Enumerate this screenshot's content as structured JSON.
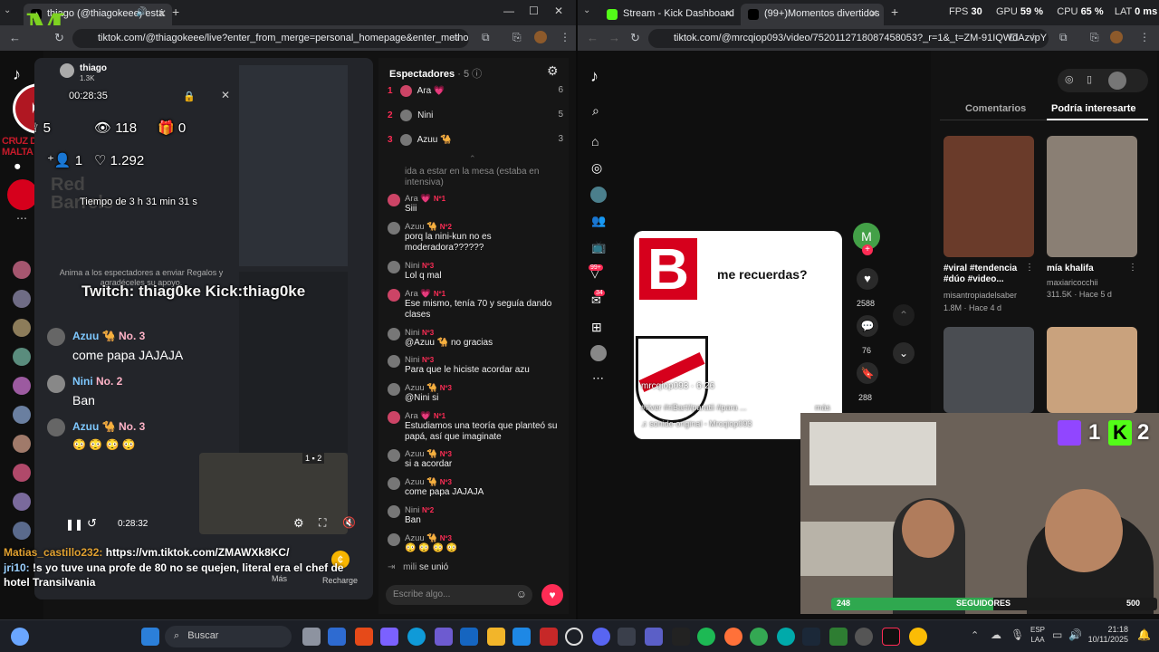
{
  "left_window": {
    "tab_title": "thiago (@thiagokeee) está",
    "url": "tiktok.com/@thiagokeee/live?enter_from_merge=personal_homepage&enter_method=othe..."
  },
  "stream": {
    "streamer_name": "thiago",
    "stream_viewers_small": "1.3K",
    "timer": "00:28:35",
    "stats": {
      "rank": "5",
      "viewers": "118",
      "gifts": "0",
      "follows": "1",
      "likes": "1.292"
    },
    "subathon": "Tiempo de 3 h 31 min 31 s",
    "team_logo_text": "CRUZ DE MALTA",
    "sponsor_text": "Red Barrels",
    "gift_hint": "Anima a los espectadores a enviar Regalos y agradéceles su apoyo.",
    "twitch_banner": "Twitch: thiag0ke Kick:thiag0ke",
    "overlay_chat": [
      {
        "user": "Azuu 🐪",
        "badge": "No. 3",
        "msg": "come papa JAJAJA"
      },
      {
        "user": "Nini",
        "badge": "No. 2",
        "msg": "Ban"
      },
      {
        "user": "Azuu 🐪",
        "badge": "No. 3",
        "msg": "😳 😳 😳 😳"
      }
    ],
    "player_time": "0:28:32",
    "twitch_counter": "1",
    "kick_counter": "2",
    "bottom_chat": [
      {
        "user": "Matias_castillo232:",
        "msg": "https://vm.tiktok.com/ZMAWXk8KC/"
      },
      {
        "user": "jri10:",
        "msg": "!s yo tuve una profe de 80 no se quejen, literal era el chef de hotel Transilvania"
      }
    ],
    "more_label": "Más",
    "recharge_label": "Recharge"
  },
  "chat_panel": {
    "title": "Espectadores",
    "count": "· 5",
    "top_viewers": [
      {
        "rank": "1",
        "name": "Ara 💗",
        "value": "6"
      },
      {
        "rank": "2",
        "name": "Nini",
        "value": "5"
      },
      {
        "rank": "3",
        "name": "Azuu 🐪",
        "value": "3"
      }
    ],
    "messages": [
      {
        "user": "",
        "badge": "",
        "msg": "ida a estar en la mesa (estaba en intensiva)"
      },
      {
        "user": "Ara 💗",
        "badge": "Nº1",
        "msg": "Siii"
      },
      {
        "user": "Azuu 🐪",
        "badge": "Nº2",
        "msg": "porq la nini-kun no es moderadora??????"
      },
      {
        "user": "Nini",
        "badge": "Nº3",
        "msg": "Lol q mal"
      },
      {
        "user": "Ara 💗",
        "badge": "Nº1",
        "msg": "Ese mismo, tenía 70 y seguía dando clases"
      },
      {
        "user": "Nini",
        "badge": "Nº3",
        "msg": "@Azuu 🐪 no gracias"
      },
      {
        "user": "Nini",
        "badge": "Nº3",
        "msg": "Para que le hiciste acordar azu"
      },
      {
        "user": "Azuu 🐪",
        "badge": "Nº3",
        "msg": "@Nini si"
      },
      {
        "user": "Ara 💗",
        "badge": "Nº1",
        "msg": "Estudiamos una teoría que planteó su papá, así que imaginate"
      },
      {
        "user": "Azuu 🐪",
        "badge": "Nº3",
        "msg": "si a acordar"
      },
      {
        "user": "Azuu 🐪",
        "badge": "Nº3",
        "msg": "come papa JAJAJA"
      },
      {
        "user": "Nini",
        "badge": "Nº2",
        "msg": "Ban"
      },
      {
        "user": "Azuu 🐪",
        "badge": "Nº3",
        "msg": "😳 😳 😳 😳"
      }
    ],
    "join_user": "mili",
    "join_text": "se unió",
    "input_placeholder": "Escribe algo..."
  },
  "right_window": {
    "tab1_title": "Stream - Kick Dashboard",
    "tab2_title": "(99+)Momentos divertidos",
    "url": "tiktok.com/@mrcqiop093/video/7520112718087458053?_r=1&_t=ZM-91IQWdAzvpY",
    "perf": {
      "fps_label": "FPS",
      "fps": "30",
      "gpu_label": "GPU",
      "gpu": "59 %",
      "cpu_label": "CPU",
      "cpu": "65 %",
      "lat_label": "LAT",
      "lat": "0 ms"
    },
    "sidebar_badges": {
      "inbox": "99+",
      "messages": "34"
    },
    "video": {
      "caption": "me recuerdas?",
      "author": "mrcqiop093 · 6-26",
      "hashtags": "#river #riBart#paratii #para ...",
      "more": "más",
      "sound": "sonido original - Mrcqiop093",
      "likes": "2588",
      "comments": "76",
      "saves": "288"
    },
    "tabs": {
      "comments": "Comentarios",
      "may_interest": "Podría interesarte"
    },
    "recommended": [
      {
        "title": "#viral #tendencia #dúo #video...",
        "author": "misantropiadelsaber",
        "meta": "1.8M · Hace 4 d"
      },
      {
        "title": "mía khalifa",
        "author": "maxiaricocchii",
        "meta": "311.5K · Hace 5 d"
      }
    ],
    "webcam": {
      "twitch_count": "1",
      "kick_count": "2",
      "followers_current": "248",
      "followers_label": "SEGUIDORES",
      "followers_goal": "500",
      "followers_progress": 0.496
    }
  },
  "taskbar": {
    "search_placeholder": "Buscar",
    "lang": "ESP",
    "lang2": "LAA",
    "time": "21:18",
    "date": "10/11/2025"
  }
}
